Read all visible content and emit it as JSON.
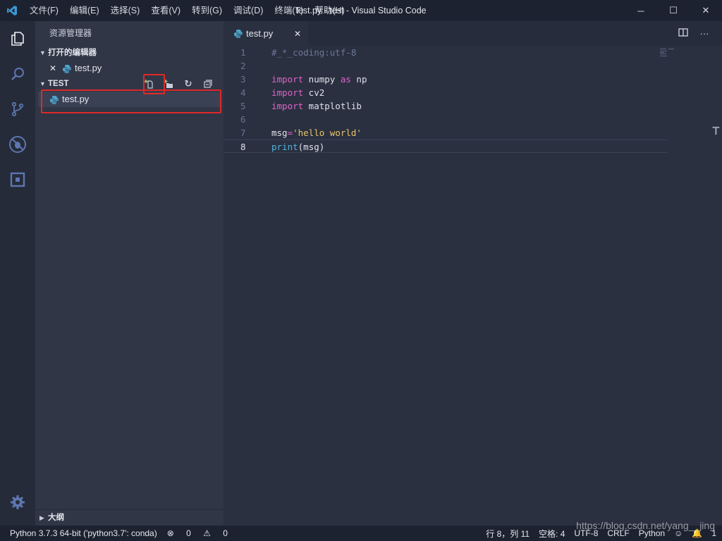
{
  "titlebar": {
    "menu": [
      "文件(F)",
      "编辑(E)",
      "选择(S)",
      "查看(V)",
      "转到(G)",
      "调试(D)",
      "终端(T)",
      "帮助(H)"
    ],
    "title": "test.py - test - Visual Studio Code"
  },
  "sidebar": {
    "header": "资源管理器",
    "open_editors": {
      "title": "打开的编辑器",
      "file": "test.py"
    },
    "folder": {
      "title": "TEST",
      "file": "test.py"
    },
    "outline": "大纲"
  },
  "editor": {
    "tab": "test.py",
    "lines": [
      {
        "n": "1",
        "tokens": [
          {
            "t": "#_*_coding:utf-8",
            "c": "cm"
          }
        ]
      },
      {
        "n": "2",
        "tokens": []
      },
      {
        "n": "3",
        "tokens": [
          {
            "t": "import",
            "c": "kw"
          },
          {
            "t": " numpy ",
            "c": "id"
          },
          {
            "t": "as",
            "c": "kw"
          },
          {
            "t": " np",
            "c": "id"
          }
        ]
      },
      {
        "n": "4",
        "tokens": [
          {
            "t": "import",
            "c": "kw"
          },
          {
            "t": " cv2",
            "c": "id"
          }
        ]
      },
      {
        "n": "5",
        "tokens": [
          {
            "t": "import",
            "c": "kw"
          },
          {
            "t": " matplotlib",
            "c": "id"
          }
        ]
      },
      {
        "n": "6",
        "tokens": []
      },
      {
        "n": "7",
        "tokens": [
          {
            "t": "msg",
            "c": "id"
          },
          {
            "t": "=",
            "c": "op"
          },
          {
            "t": "'hello world'",
            "c": "str"
          }
        ]
      },
      {
        "n": "8",
        "tokens": [
          {
            "t": "print",
            "c": "fn"
          },
          {
            "t": "(msg)",
            "c": "id"
          }
        ]
      }
    ]
  },
  "statusbar": {
    "interpreter": "Python 3.7.3 64-bit ('python3.7': conda)",
    "errors": "0",
    "warnings": "0",
    "position": "行 8，列 11",
    "indent": "空格: 4",
    "encoding": "UTF-8",
    "eol": "CRLF",
    "language": "Python",
    "notifications": "1"
  },
  "watermark": "https://blog.csdn.net/yang__jing",
  "colors": {
    "accent": "#e062c9",
    "highlight_box": "#e02828",
    "background": "#2a3040"
  }
}
